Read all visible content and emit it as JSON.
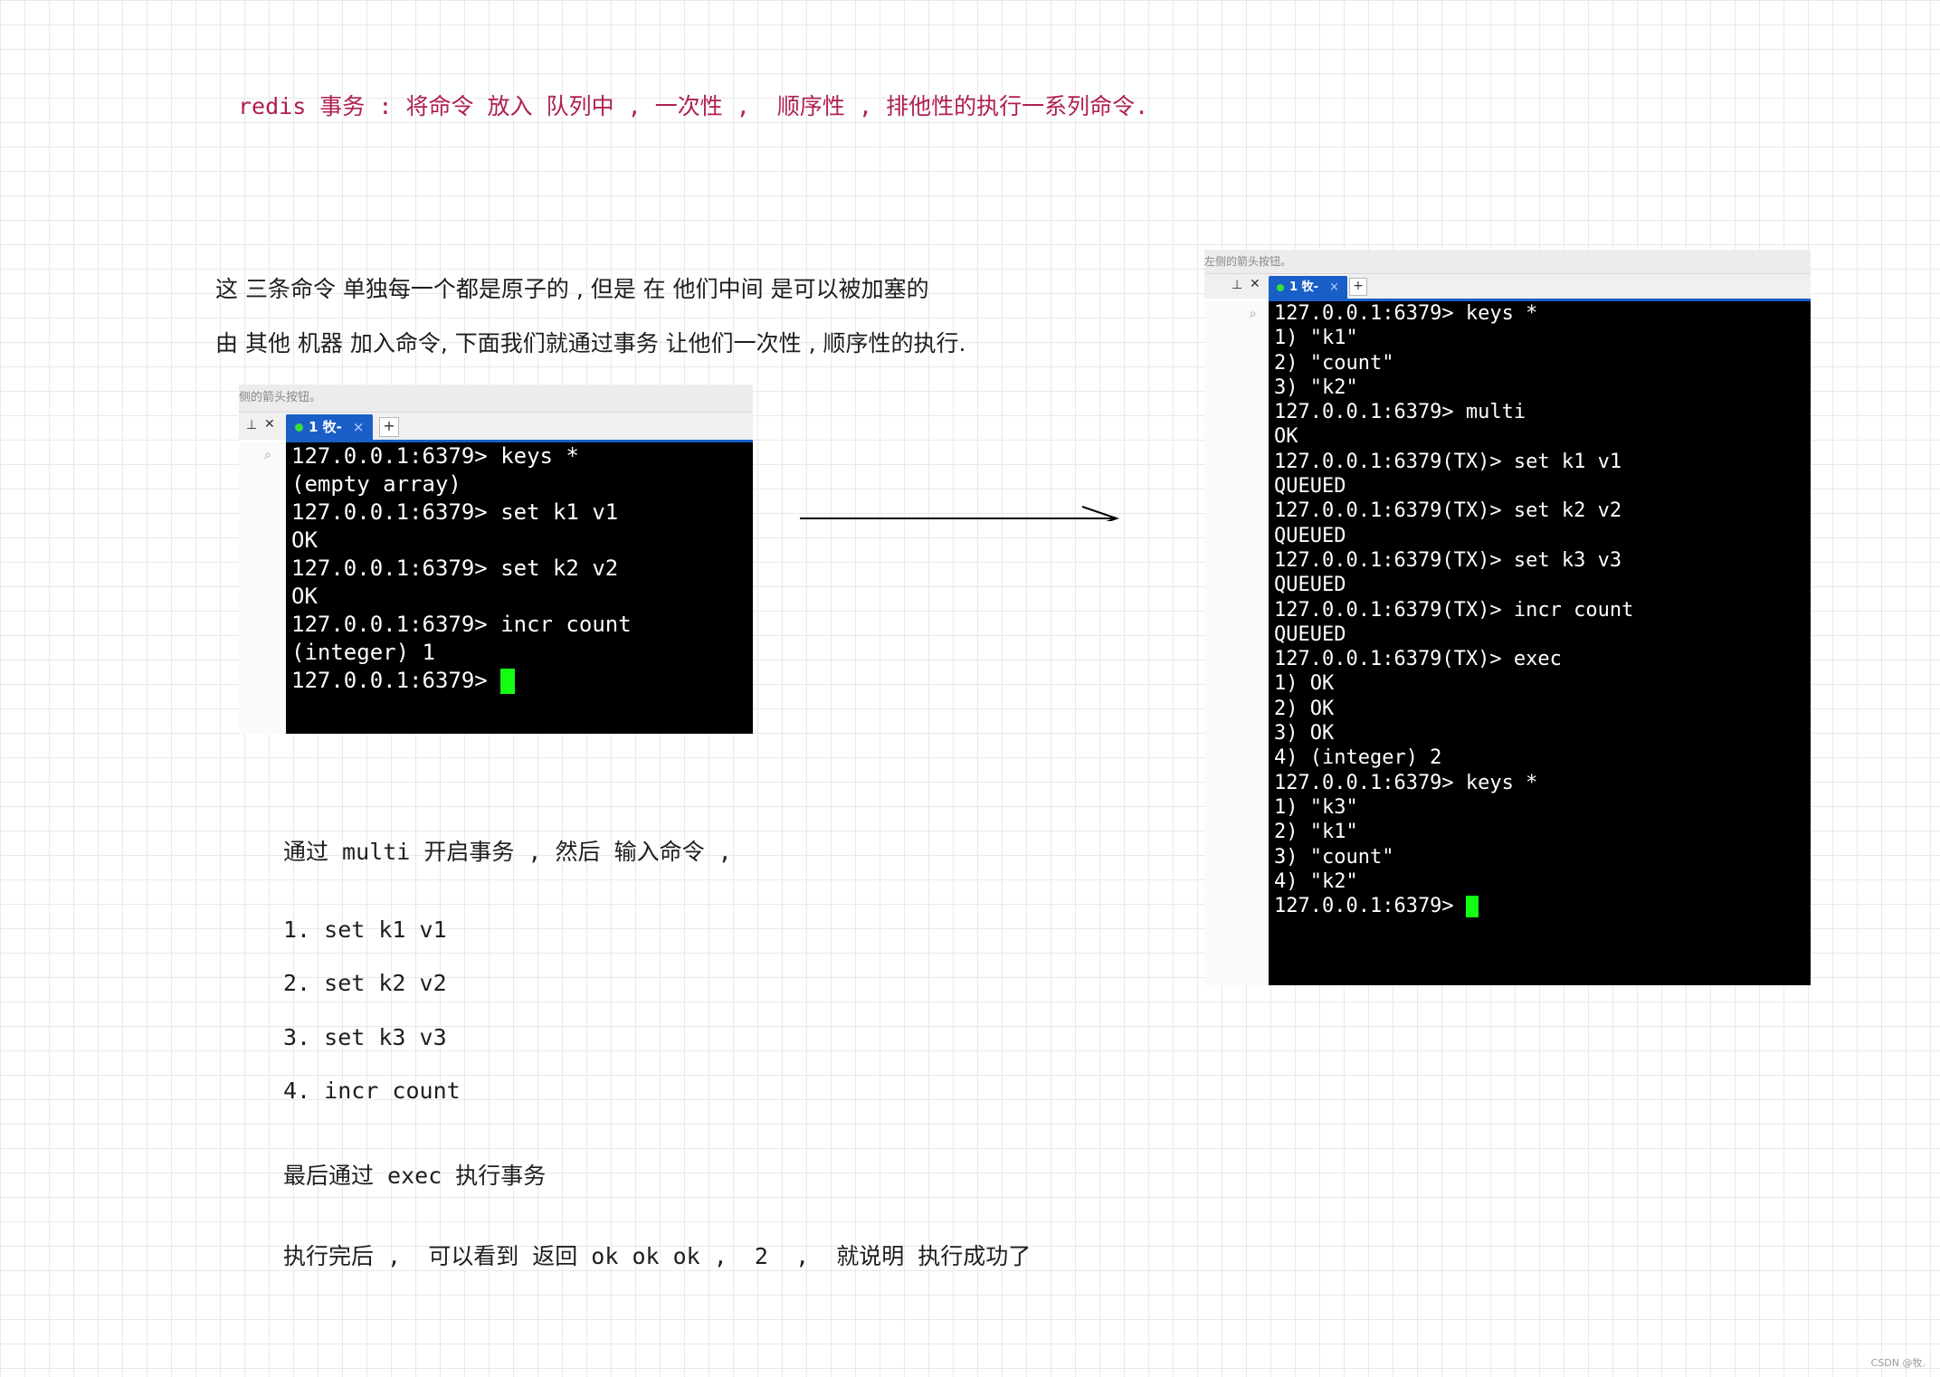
{
  "title": {
    "part1": "redis 事务 : 将命令 放入 队列中 , 一次性 ,  顺序性 , 排他性的执行一系列命令."
  },
  "intro": {
    "line1": "这 三条命令 单独每一个都是原子的 , 但是 在 他们中间 是可以被加塞的",
    "line2": "由 其他 机器 加入命令, 下面我们就通过事务 让他们一次性 , 顺序性的执行."
  },
  "term_small": {
    "hint": "侧的箭头按钮。",
    "pin_icon": "pin-icon",
    "close_icon": "close-icon",
    "tab_label": "1 牧-",
    "tab_close": "×",
    "new_tab": "+",
    "lines": [
      "127.0.0.1:6379> keys *",
      "(empty array)",
      "127.0.0.1:6379> set k1 v1",
      "OK",
      "127.0.0.1:6379> set k2 v2",
      "OK",
      "127.0.0.1:6379> incr count",
      "(integer) 1",
      "127.0.0.1:6379> "
    ]
  },
  "term_large": {
    "hint": "左侧的箭头按钮。",
    "tab_label": "1 牧-",
    "tab_close": "×",
    "new_tab": "+",
    "lines": [
      "127.0.0.1:6379> keys *",
      "1) \"k1\"",
      "2) \"count\"",
      "3) \"k2\"",
      "127.0.0.1:6379> multi",
      "OK",
      "127.0.0.1:6379(TX)> set k1 v1",
      "QUEUED",
      "127.0.0.1:6379(TX)> set k2 v2",
      "QUEUED",
      "127.0.0.1:6379(TX)> set k3 v3",
      "QUEUED",
      "127.0.0.1:6379(TX)> incr count",
      "QUEUED",
      "127.0.0.1:6379(TX)> exec",
      "1) OK",
      "2) OK",
      "3) OK",
      "4) (integer) 2",
      "127.0.0.1:6379> keys *",
      "1) \"k3\"",
      "2) \"k1\"",
      "3) \"count\"",
      "4) \"k2\"",
      "127.0.0.1:6379> "
    ]
  },
  "steps": {
    "intro": "通过 multi 开启事务 , 然后 输入命令 ,",
    "items": [
      "1. set k1 v1",
      "2. set k2 v2",
      "3. set k3 v3",
      "4. incr count"
    ],
    "exec": "最后通过 exec 执行事务",
    "result": "执行完后 ,  可以看到 返回 ok ok ok ,  2  ,  就说明 执行成功了"
  },
  "watermark": "CSDN @牧."
}
